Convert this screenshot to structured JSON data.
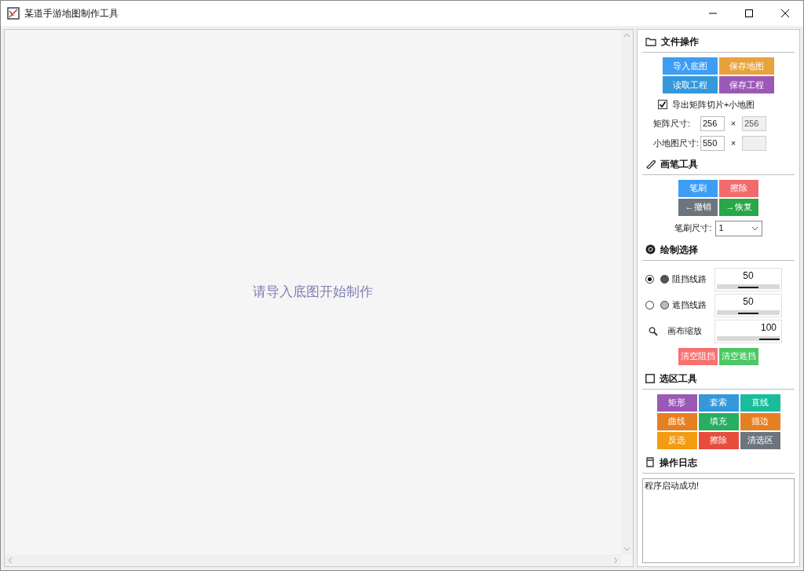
{
  "window": {
    "title": "某道手游地图制作工具"
  },
  "canvas": {
    "hint": "请导入底图开始制作"
  },
  "file_ops": {
    "title": "文件操作",
    "buttons": [
      {
        "label": "导入底图",
        "color": "#3d9df5"
      },
      {
        "label": "保存地图",
        "color": "#e8a23c"
      },
      {
        "label": "读取工程",
        "color": "#3498db"
      },
      {
        "label": "保存工程",
        "color": "#9b59b6"
      }
    ],
    "export": {
      "label": "导出矩阵切片+小地图",
      "checked": true
    },
    "sizes": [
      {
        "label": "矩阵尺寸:",
        "first": "256",
        "times": "×",
        "second": "256",
        "second_disabled": true
      },
      {
        "label": "小地图尺寸:",
        "first": "550",
        "times": "×",
        "second_disabled": true
      }
    ]
  },
  "brush": {
    "title": "画笔工具",
    "buttons": [
      {
        "label": "笔刷",
        "color": "#3d9df5"
      },
      {
        "label": "擦除",
        "color": "#f26b6b"
      },
      {
        "label": "←撤销",
        "color": "#6c757d"
      },
      {
        "label": "→恢复",
        "color": "#28a745"
      }
    ],
    "size": {
      "label": "笔刷尺寸:",
      "value": "1"
    }
  },
  "draw": {
    "title": "绘制选择",
    "items": [
      {
        "kind": "radio",
        "label": "阻挡线路",
        "selected": true,
        "color": "#555555",
        "value": "50",
        "level": 0.5
      },
      {
        "kind": "radio",
        "label": "遮挡线路",
        "selected": false,
        "color": "#bbbbbb",
        "value": "50",
        "level": 0.5
      },
      {
        "kind": "zoom",
        "label": "画布缩放",
        "value": "100",
        "level": 1
      }
    ],
    "buttons": [
      {
        "label": "清空阻挡",
        "color": "#f87171"
      },
      {
        "label": "清空遮挡",
        "color": "#4cc764"
      }
    ]
  },
  "select": {
    "title": "选区工具",
    "buttons": [
      {
        "label": "矩形",
        "color": "#9b59b6"
      },
      {
        "label": "套索",
        "color": "#3498db"
      },
      {
        "label": "直线",
        "color": "#1abc9c"
      },
      {
        "label": "曲线",
        "color": "#e67e22"
      },
      {
        "label": "填充",
        "color": "#27ae60"
      },
      {
        "label": "描边",
        "color": "#e67e22"
      },
      {
        "label": "反选",
        "color": "#f39c12"
      },
      {
        "label": "擦除",
        "color": "#e74c3c"
      },
      {
        "label": "清选区",
        "color": "#6c757d"
      }
    ]
  },
  "log": {
    "title": "操作日志",
    "lines": [
      "程序启动成功!"
    ]
  }
}
